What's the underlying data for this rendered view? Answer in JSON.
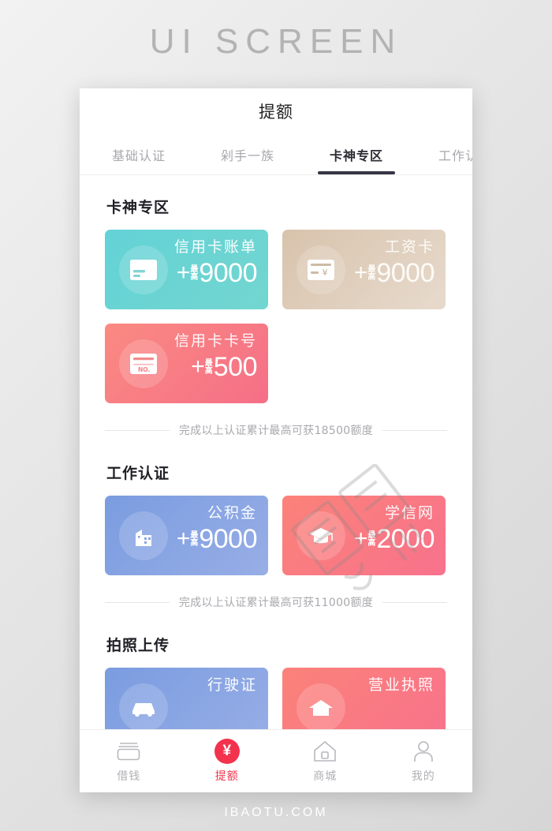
{
  "poster": {
    "title": "UI SCREEN",
    "footer_brand": "IBAOTU.COM",
    "watermark_text": "包图网"
  },
  "app": {
    "header_title": "提额"
  },
  "tabs": [
    {
      "label": "基础认证",
      "active": false
    },
    {
      "label": "剁手一族",
      "active": false
    },
    {
      "label": "卡神专区",
      "active": true
    },
    {
      "label": "工作认证",
      "active": false
    }
  ],
  "sections": [
    {
      "title": "卡神专区",
      "cards": [
        {
          "label": "信用卡账单",
          "plus": "+",
          "max_top": "最",
          "max_bottom": "高",
          "amount": "9000",
          "icon": "credit-card-bill-icon",
          "color_from": "#63D2D6",
          "color_to": "#73D6D0"
        },
        {
          "label": "工资卡",
          "plus": "+",
          "max_top": "最",
          "max_bottom": "高",
          "amount": "9000",
          "icon": "salary-card-icon",
          "color_from": "#D8C3AC",
          "color_to": "#E7DACD"
        },
        {
          "label": "信用卡卡号",
          "plus": "+",
          "max_top": "最",
          "max_bottom": "高",
          "amount": "500",
          "icon": "card-number-icon",
          "color_from": "#FA8A82",
          "color_to": "#F56F87"
        }
      ],
      "note": "完成以上认证累计最高可获18500额度"
    },
    {
      "title": "工作认证",
      "cards": [
        {
          "label": "公积金",
          "plus": "+",
          "max_top": "最",
          "max_bottom": "高",
          "amount": "9000",
          "icon": "building-icon",
          "color_from": "#7A9CE0",
          "color_to": "#98AEE6"
        },
        {
          "label": "学信网",
          "plus": "+",
          "max_top": "最",
          "max_bottom": "高",
          "amount": "2000",
          "icon": "graduation-cap-icon",
          "color_from": "#FB8279",
          "color_to": "#F8728C"
        }
      ],
      "note": "完成以上认证累计最高可获11000额度"
    },
    {
      "title": "拍照上传",
      "cards": [
        {
          "label": "行驶证",
          "plus": "",
          "max_top": "",
          "max_bottom": "",
          "amount": "",
          "icon": "car-icon",
          "color_from": "#7A9CE0",
          "color_to": "#98AEE6"
        },
        {
          "label": "营业执照",
          "plus": "",
          "max_top": "",
          "max_bottom": "",
          "amount": "",
          "icon": "license-icon",
          "color_from": "#FB8279",
          "color_to": "#F8728C"
        }
      ],
      "note": ""
    }
  ],
  "bottom_nav": [
    {
      "label": "借钱",
      "icon": "wallet-icon",
      "active": false
    },
    {
      "label": "提额",
      "icon": "yuan-circle-icon",
      "symbol": "¥",
      "active": true
    },
    {
      "label": "商城",
      "icon": "home-icon",
      "active": false
    },
    {
      "label": "我的",
      "icon": "person-icon",
      "active": false
    }
  ],
  "colors": {
    "accent_red": "#f3334d",
    "tab_active": "#363646",
    "muted_text": "#a9a9ae"
  }
}
